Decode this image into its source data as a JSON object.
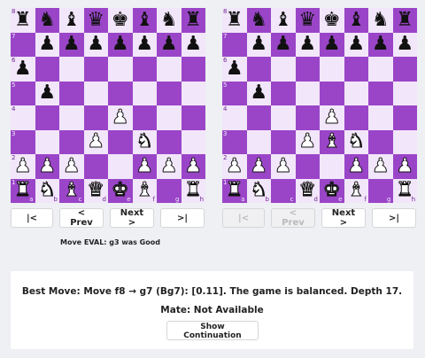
{
  "boards": {
    "left": {
      "ranks": [
        [
          "r",
          "n",
          "b",
          "q",
          "k",
          "b",
          "n",
          "r"
        ],
        [
          " ",
          "p",
          "p",
          "p",
          "p",
          "p",
          "p",
          "p"
        ],
        [
          "p",
          " ",
          " ",
          " ",
          " ",
          " ",
          " ",
          " "
        ],
        [
          " ",
          "p",
          " ",
          " ",
          " ",
          " ",
          " ",
          " "
        ],
        [
          " ",
          " ",
          " ",
          " ",
          "P",
          " ",
          " ",
          " "
        ],
        [
          " ",
          " ",
          " ",
          "P",
          " ",
          "N",
          " ",
          " "
        ],
        [
          "P",
          "P",
          "P",
          " ",
          " ",
          "P",
          "P",
          "P"
        ],
        [
          "R",
          "N",
          "B",
          "Q",
          "K",
          "B",
          " ",
          "R"
        ]
      ],
      "rank_labels": [
        "8",
        "7",
        "6",
        "5",
        "4",
        "3",
        "2",
        "1"
      ],
      "file_labels": [
        "a",
        "b",
        "c",
        "d",
        "e",
        "f",
        "g",
        "h"
      ]
    },
    "right": {
      "ranks": [
        [
          "r",
          "n",
          "b",
          "q",
          "k",
          "b",
          "n",
          "r"
        ],
        [
          " ",
          "p",
          "p",
          "p",
          "p",
          "p",
          "p",
          "p"
        ],
        [
          "p",
          " ",
          " ",
          " ",
          " ",
          " ",
          " ",
          " "
        ],
        [
          " ",
          "p",
          " ",
          " ",
          " ",
          " ",
          " ",
          " "
        ],
        [
          " ",
          " ",
          " ",
          " ",
          "P",
          " ",
          " ",
          " "
        ],
        [
          " ",
          " ",
          " ",
          "P",
          "B",
          "N",
          " ",
          " "
        ],
        [
          "P",
          "P",
          "P",
          " ",
          " ",
          "P",
          "P",
          "P"
        ],
        [
          "R",
          "N",
          " ",
          "Q",
          "K",
          "B",
          " ",
          "R"
        ]
      ],
      "rank_labels": [
        "8",
        "7",
        "6",
        "5",
        "4",
        "3",
        "2",
        "1"
      ],
      "file_labels": [
        "a",
        "b",
        "c",
        "d",
        "e",
        "f",
        "g",
        "h"
      ]
    }
  },
  "nav_left": {
    "first": "|<",
    "prev": "< Prev",
    "next": "Next >",
    "last": ">|"
  },
  "nav_right": {
    "first": "|<",
    "prev": "< Prev",
    "next": "Next >",
    "last": ">|"
  },
  "eval": {
    "text": "Move EVAL: g3 was Good"
  },
  "analysis": {
    "best_move": "Best Move: Move f8 → g7 (Bg7): [0.11]. The game is balanced. Depth 17.",
    "mate": "Mate: Not Available",
    "button": "Show Continuation"
  },
  "colors": {
    "light_square": "#f2e6fa",
    "dark_square": "#9a45c8"
  }
}
